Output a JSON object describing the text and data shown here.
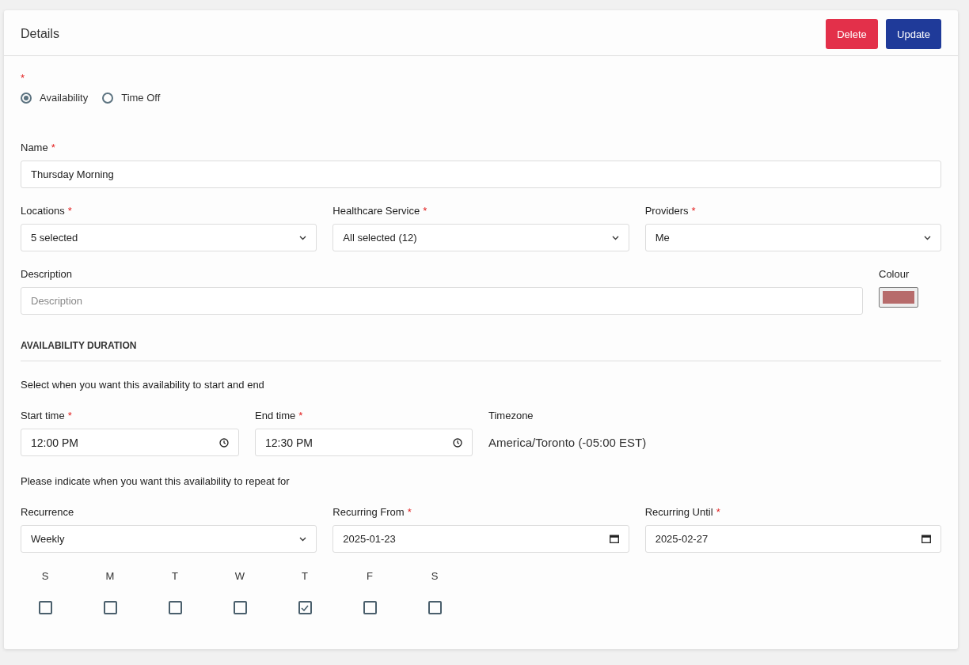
{
  "card": {
    "title": "Details"
  },
  "header_buttons": [
    {
      "label": "Delete",
      "kind": "danger"
    },
    {
      "label": "Update",
      "kind": "primary"
    }
  ],
  "entry_type": {
    "required_mark": "*",
    "options": [
      {
        "label": "Availability",
        "selected": true
      },
      {
        "label": "Time Off",
        "selected": false
      }
    ]
  },
  "name": {
    "label": "Name",
    "required_mark": "*",
    "value": "Thursday Morning"
  },
  "selectors": [
    {
      "label": "Locations",
      "required_mark": "*",
      "value": "5 selected"
    },
    {
      "label": "Healthcare Service",
      "required_mark": "*",
      "value": "All selected (12)"
    },
    {
      "label": "Providers",
      "required_mark": "*",
      "value": "Me"
    }
  ],
  "description": {
    "label": "Description",
    "placeholder": "Description"
  },
  "colour": {
    "label": "Colour",
    "color": "#b76b6b"
  },
  "section": {
    "title": "AVAILABILITY DURATION",
    "hint": "Select when you want this availability to start and end"
  },
  "times": [
    {
      "label": "Start time",
      "required_mark": "*",
      "value": "12:00 PM"
    },
    {
      "label": "End time",
      "required_mark": "*",
      "value": "12:30 PM"
    }
  ],
  "timezone": {
    "label": "Timezone",
    "value": "America/Toronto (-05:00 EST)"
  },
  "repeat_hint": "Please indicate when you want this availability to repeat for",
  "recurrence": [
    {
      "kind": "select",
      "label": "Recurrence",
      "value": "Weekly"
    },
    {
      "kind": "date",
      "label": "Recurring From",
      "required_mark": "*",
      "value": "2025-01-23"
    },
    {
      "kind": "date",
      "label": "Recurring Until",
      "required_mark": "*",
      "value": "2025-02-27"
    }
  ],
  "days": [
    {
      "label": "S",
      "checked": false
    },
    {
      "label": "M",
      "checked": false
    },
    {
      "label": "T",
      "checked": false
    },
    {
      "label": "W",
      "checked": false
    },
    {
      "label": "T",
      "checked": true
    },
    {
      "label": "F",
      "checked": false
    },
    {
      "label": "S",
      "checked": false
    }
  ]
}
